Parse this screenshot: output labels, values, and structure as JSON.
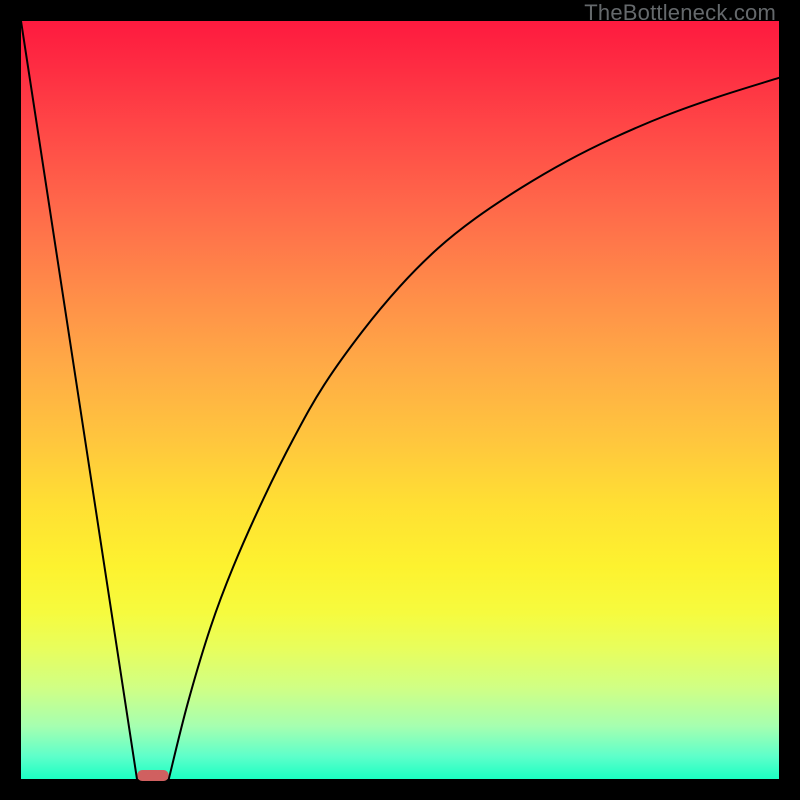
{
  "watermark": {
    "text": "TheBottleneck.com"
  },
  "chart_data": {
    "type": "line",
    "title": "",
    "xlabel": "",
    "ylabel": "",
    "xlim": [
      0,
      100
    ],
    "ylim": [
      0,
      100
    ],
    "grid": false,
    "legend": false,
    "series": [
      {
        "name": "left-segment",
        "x": [
          0,
          15.3
        ],
        "y": [
          100,
          0
        ]
      },
      {
        "name": "right-curve",
        "x": [
          19.5,
          22,
          25,
          28,
          32,
          36,
          40,
          45,
          50,
          55,
          60,
          66,
          72,
          78,
          85,
          92,
          100
        ],
        "y": [
          0,
          10,
          20,
          28,
          37,
          45,
          52,
          59,
          65,
          70,
          74,
          78,
          81.5,
          84.5,
          87.5,
          90,
          92.5
        ]
      }
    ],
    "marker": {
      "name": "min-marker",
      "x_center": 17.4,
      "width_pct": 4.2,
      "color": "#d06060"
    },
    "gradient_stops": [
      {
        "pos": 0,
        "color": "#fe1a3f"
      },
      {
        "pos": 50,
        "color": "#ffc53e"
      },
      {
        "pos": 75,
        "color": "#fdf22f"
      },
      {
        "pos": 100,
        "color": "#1bffc3"
      }
    ]
  }
}
